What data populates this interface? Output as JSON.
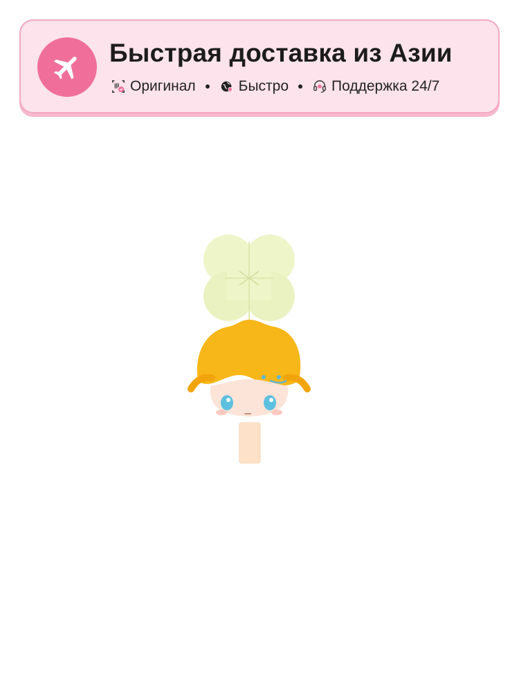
{
  "banner": {
    "title": "Быстрая доставка из Азии",
    "icon": "airplane-icon",
    "accent_color": "#ef6f9a",
    "background_color": "#fde3ec",
    "features": [
      {
        "icon": "barcode-icon",
        "label": "Оригинал"
      },
      {
        "icon": "globe-icon",
        "label": "Быстро"
      },
      {
        "icon": "headset-icon",
        "label": "Поддержка 24/7"
      }
    ]
  },
  "product": {
    "image": "figure-with-clover-hat"
  }
}
